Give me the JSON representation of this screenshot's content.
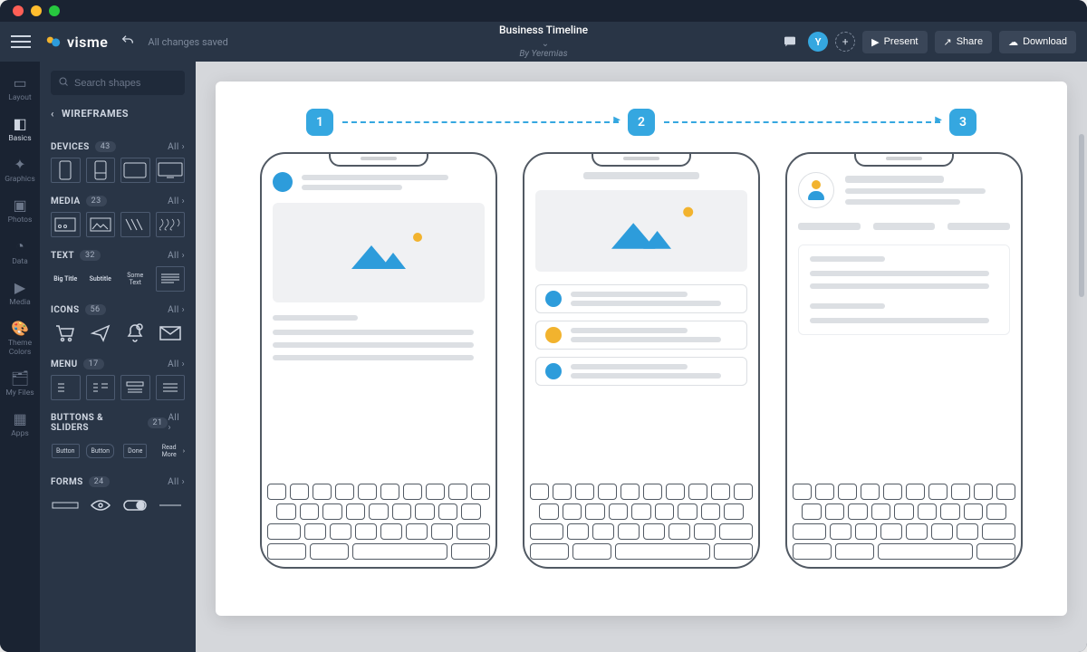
{
  "app": {
    "name": "visme"
  },
  "topbar": {
    "save_state": "All changes saved",
    "doc_title": "Business Timeline",
    "doc_subtitle": "By Yeremias",
    "avatar_initial": "Y",
    "present_label": "Present",
    "share_label": "Share",
    "download_label": "Download"
  },
  "rail": {
    "items": [
      {
        "label": "Layout"
      },
      {
        "label": "Basics"
      },
      {
        "label": "Graphics"
      },
      {
        "label": "Photos"
      },
      {
        "label": "Data"
      },
      {
        "label": "Media"
      },
      {
        "label": "Theme Colors"
      },
      {
        "label": "My Files"
      },
      {
        "label": "Apps"
      }
    ]
  },
  "panel": {
    "search_placeholder": "Search shapes",
    "title": "WIREFRAMES",
    "all_label": "All",
    "categories": [
      {
        "name": "DEVICES",
        "count": "43"
      },
      {
        "name": "MEDIA",
        "count": "23"
      },
      {
        "name": "TEXT",
        "count": "32",
        "samples": [
          "Big Title",
          "Subtitle",
          "Some Text"
        ]
      },
      {
        "name": "ICONS",
        "count": "56"
      },
      {
        "name": "MENU",
        "count": "17"
      },
      {
        "name": "BUTTONS & SLIDERS",
        "count": "21",
        "samples": [
          "Button",
          "Button",
          "Done",
          "Read More"
        ]
      },
      {
        "name": "FORMS",
        "count": "24"
      }
    ]
  },
  "canvas": {
    "steps": [
      "1",
      "2",
      "3"
    ]
  }
}
